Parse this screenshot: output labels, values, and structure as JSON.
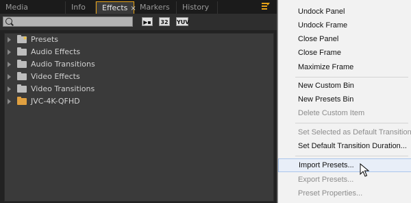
{
  "tabs": [
    {
      "label": "Media Browser",
      "active": false
    },
    {
      "label": "Info",
      "active": false
    },
    {
      "label": "Effects",
      "active": true,
      "close": "×"
    },
    {
      "label": "Markers",
      "active": false
    },
    {
      "label": "History",
      "active": false
    }
  ],
  "toolbar": {
    "search_value": "",
    "buttons": [
      "32",
      "YUV"
    ]
  },
  "tree": [
    {
      "label": "Presets",
      "icon": "presets-folder-icon"
    },
    {
      "label": "Audio Effects",
      "icon": "folder-icon"
    },
    {
      "label": "Audio Transitions",
      "icon": "folder-icon"
    },
    {
      "label": "Video Effects",
      "icon": "folder-icon"
    },
    {
      "label": "Video Transitions",
      "icon": "folder-icon"
    },
    {
      "label": "JVC-4K-QFHD",
      "icon": "folder-orange-icon"
    }
  ],
  "menu": {
    "items": [
      {
        "label": "Undock Panel",
        "enabled": true
      },
      {
        "label": "Undock Frame",
        "enabled": true
      },
      {
        "label": "Close Panel",
        "enabled": true
      },
      {
        "label": "Close Frame",
        "enabled": true
      },
      {
        "label": "Maximize Frame",
        "enabled": true
      },
      {
        "label": "New Custom Bin",
        "enabled": true
      },
      {
        "label": "New Presets Bin",
        "enabled": true
      },
      {
        "label": "Delete Custom Item",
        "enabled": false
      },
      {
        "label": "Set Selected as Default Transition",
        "enabled": false
      },
      {
        "label": "Set Default Transition Duration...",
        "enabled": true
      },
      {
        "label": "Import Presets...",
        "enabled": true,
        "hovered": true
      },
      {
        "label": "Export Presets...",
        "enabled": false
      },
      {
        "label": "Preset Properties...",
        "enabled": false
      }
    ]
  },
  "colors": {
    "accent": "#e8a317",
    "panel_bg": "#3a3a3a",
    "menu_bg": "#f2f2f2",
    "hover_bg": "#e8eef8"
  }
}
